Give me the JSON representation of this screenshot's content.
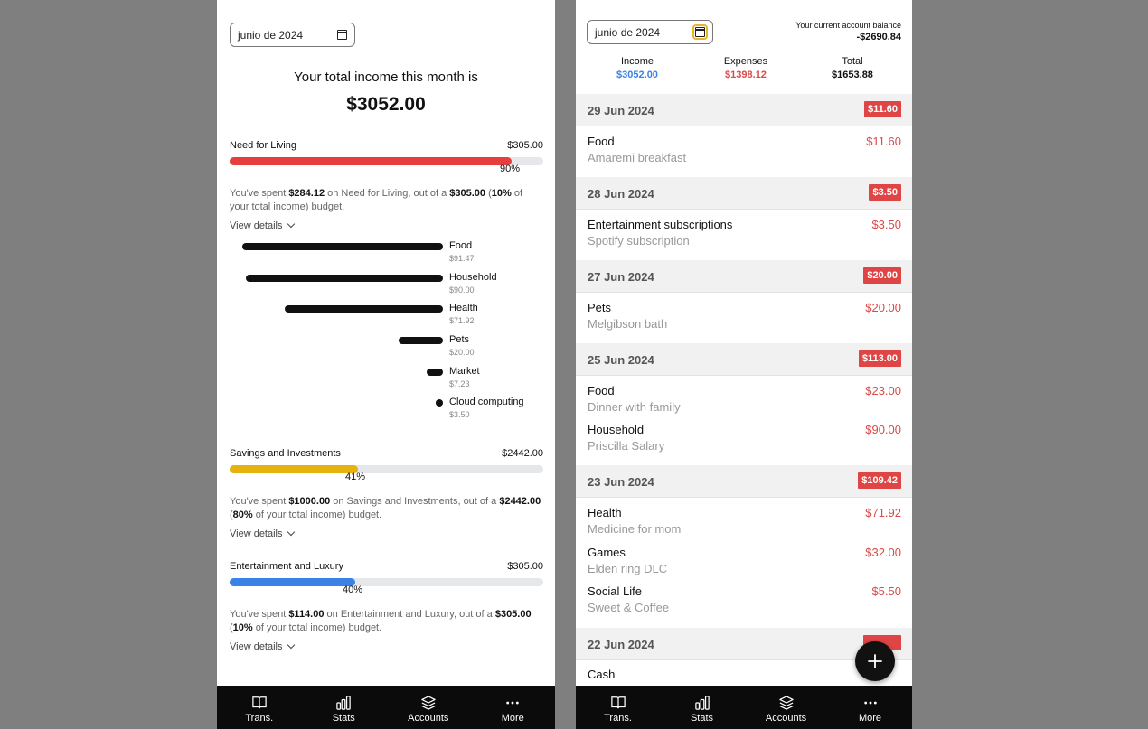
{
  "left": {
    "date_value": "junio de 2024",
    "income_title": "Your total income this month is",
    "income_amount": "$3052.00",
    "categories": [
      {
        "name": "Need for Living",
        "budget": "$305.00",
        "percent_label": "90%",
        "percent": 0.9,
        "color": "#e63e3e",
        "summary": {
          "pre": "You've spent ",
          "spent": "$284.12",
          "mid": " on Need for Living, out of a ",
          "budget": "$305.00",
          "open": " (",
          "share": "10%",
          "post": " of your total income) budget."
        },
        "view_details": "View details",
        "items": [
          {
            "name": "Food",
            "value": "$91.47",
            "amount": 91.47
          },
          {
            "name": "Household",
            "value": "$90.00",
            "amount": 90.0
          },
          {
            "name": "Health",
            "value": "$71.92",
            "amount": 71.92
          },
          {
            "name": "Pets",
            "value": "$20.00",
            "amount": 20.0
          },
          {
            "name": "Market",
            "value": "$7.23",
            "amount": 7.23
          },
          {
            "name": "Cloud computing",
            "value": "$3.50",
            "amount": 3.5
          }
        ]
      },
      {
        "name": "Savings and Investments",
        "budget": "$2442.00",
        "percent_label": "41%",
        "percent": 0.41,
        "color": "#e6b30e",
        "summary": {
          "pre": "You've spent ",
          "spent": "$1000.00",
          "mid": " on Savings and Investments, out of a ",
          "budget": "$2442.00",
          "open": " (",
          "share": "80%",
          "post": " of your total income) budget."
        },
        "view_details": "View details"
      },
      {
        "name": "Entertainment and Luxury",
        "budget": "$305.00",
        "percent_label": "40%",
        "percent": 0.4,
        "color": "#3b82e6",
        "summary": {
          "pre": "You've spent ",
          "spent": "$114.00",
          "mid": " on Entertainment and Luxury, out of a ",
          "budget": "$305.00",
          "open": " (",
          "share": "10%",
          "post": " of your total income) budget."
        },
        "view_details": "View details"
      }
    ]
  },
  "right": {
    "date_value": "junio de 2024",
    "balance_label": "Your current account balance",
    "balance_value": "-$2690.84",
    "totals": {
      "income_label": "Income",
      "income_value": "$3052.00",
      "expenses_label": "Expenses",
      "expenses_value": "$1398.12",
      "total_label": "Total",
      "total_value": "$1653.88"
    },
    "days": [
      {
        "date": "29 Jun 2024",
        "badge": "$11.60",
        "items": [
          {
            "category": "Food",
            "note": "Amaremi breakfast",
            "amount": "$11.60"
          }
        ]
      },
      {
        "date": "28 Jun 2024",
        "badge": "$3.50",
        "items": [
          {
            "category": "Entertainment subscriptions",
            "note": "Spotify subscription",
            "amount": "$3.50"
          }
        ]
      },
      {
        "date": "27 Jun 2024",
        "badge": "$20.00",
        "items": [
          {
            "category": "Pets",
            "note": "Melgibson bath",
            "amount": "$20.00"
          }
        ]
      },
      {
        "date": "25 Jun 2024",
        "badge": "$113.00",
        "items": [
          {
            "category": "Food",
            "note": "Dinner with family",
            "amount": "$23.00"
          },
          {
            "category": "Household",
            "note": "Priscilla Salary",
            "amount": "$90.00"
          }
        ]
      },
      {
        "date": "23 Jun 2024",
        "badge": "$109.42",
        "items": [
          {
            "category": "Health",
            "note": "Medicine for mom",
            "amount": "$71.92"
          },
          {
            "category": "Games",
            "note": "Elden ring DLC",
            "amount": "$32.00"
          },
          {
            "category": "Social Life",
            "note": "Sweet & Coffee",
            "amount": "$5.50"
          }
        ]
      },
      {
        "date": "22 Jun 2024",
        "badge": "",
        "items": [
          {
            "category": "Cash",
            "note": "",
            "amount": ""
          }
        ]
      }
    ]
  },
  "nav": [
    {
      "label": "Trans.",
      "icon": "book-icon"
    },
    {
      "label": "Stats",
      "icon": "bar-chart-icon"
    },
    {
      "label": "Accounts",
      "icon": "layers-icon"
    },
    {
      "label": "More",
      "icon": "more-icon"
    }
  ],
  "colors": {
    "income": "#3b82e6",
    "expense": "#d94a4a",
    "badge": "#e04545",
    "nav_bg": "#0b0b0b"
  }
}
